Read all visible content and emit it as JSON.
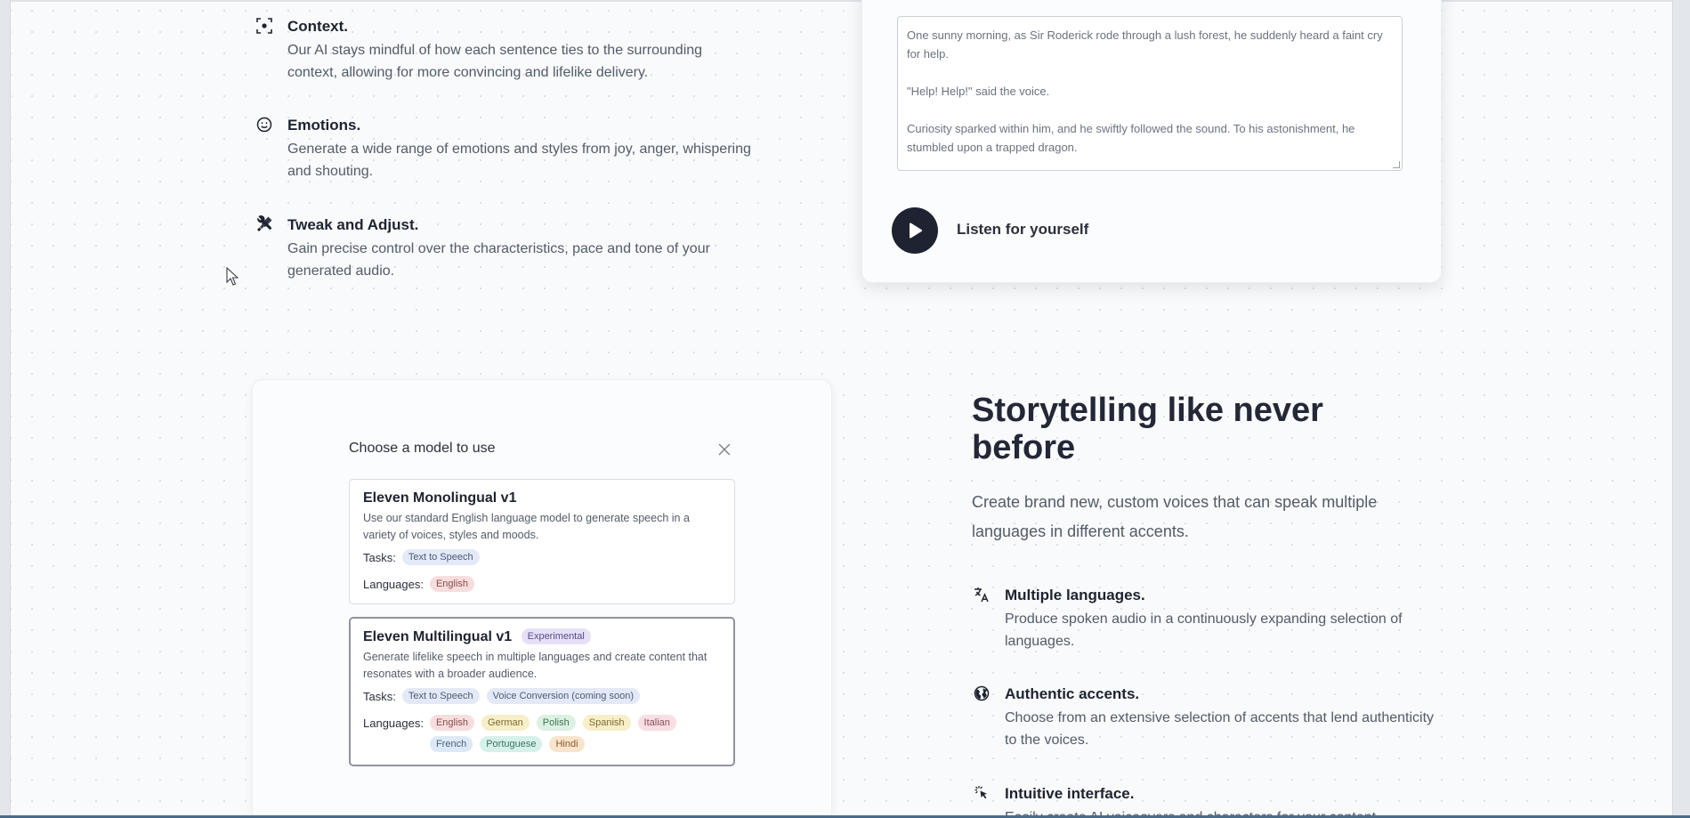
{
  "features_top": [
    {
      "icon": "focus-icon",
      "title": "Context.",
      "desc": "Our AI stays mindful of how each sentence ties to the surrounding context, allowing for more convincing and lifelike delivery."
    },
    {
      "icon": "smiley-icon",
      "title": "Emotions.",
      "desc": "Generate a wide range of emotions and styles from joy, anger, whispering and shouting."
    },
    {
      "icon": "tools-icon",
      "title": "Tweak and Adjust.",
      "desc": "Gain precise control over the characteristics, pace and tone of your generated audio."
    }
  ],
  "story": {
    "paragraphs": [
      "One sunny morning, as Sir Roderick rode through a lush forest, he suddenly heard a faint cry for help.",
      "\"Help! Help!\" said the voice.",
      "Curiosity sparked within him, and he swiftly followed the sound. To his astonishment, he stumbled upon a trapped dragon."
    ],
    "listen_label": "Listen for yourself"
  },
  "model_dialog": {
    "title": "Choose a model to use",
    "models": [
      {
        "name": "Eleven Monolingual v1",
        "badge": "",
        "desc": "Use our standard English language model to generate speech in a variety of voices, styles and moods.",
        "tasks_label": "Tasks:",
        "tasks": [
          "Text to Speech"
        ],
        "languages_label": "Languages:",
        "languages": [
          "English"
        ]
      },
      {
        "name": "Eleven Multilingual v1",
        "badge": "Experimental",
        "desc": "Generate lifelike speech in multiple languages and create content that resonates with a broader audience.",
        "tasks_label": "Tasks:",
        "tasks": [
          "Text to Speech",
          "Voice Conversion (coming soon)"
        ],
        "languages_label": "Languages:",
        "languages": [
          "English",
          "German",
          "Polish",
          "Spanish",
          "Italian",
          "French",
          "Portuguese",
          "Hindi"
        ]
      }
    ]
  },
  "storytelling": {
    "title": "Storytelling like never before",
    "subtitle": "Create brand new, custom voices that can speak multiple languages in different accents.",
    "features": [
      {
        "icon": "translate-icon",
        "title": "Multiple languages.",
        "desc": "Produce spoken audio in a continuously expanding selection of languages."
      },
      {
        "icon": "globe-icon",
        "title": "Authentic accents.",
        "desc": "Choose from an extensive selection of accents that lend authenticity to the voices."
      },
      {
        "icon": "pointer-click-icon",
        "title": "Intuitive interface.",
        "desc": "Easily create AI voiceovers and characters for your content."
      }
    ]
  },
  "colors": {
    "accent_dark": "#1f2230",
    "background": "#f8fafb"
  }
}
